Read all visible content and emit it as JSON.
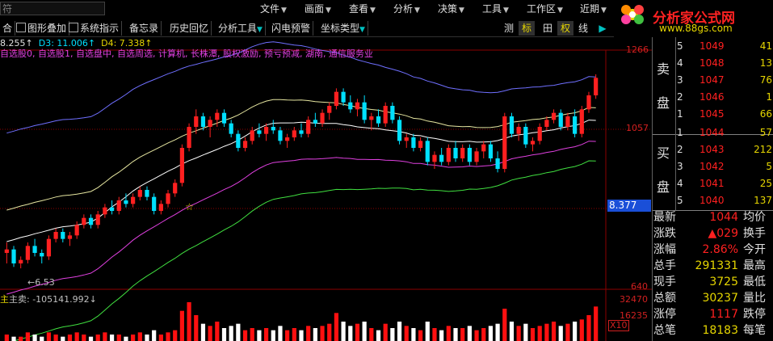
{
  "menubar": {
    "search_text": "符",
    "items": [
      "文件",
      "画面",
      "查看",
      "分析",
      "决策",
      "工具",
      "工作区",
      "近期"
    ]
  },
  "toolbar": {
    "items": [
      "合",
      "图形叠加",
      "系统指示",
      "备忘录",
      "历史回忆",
      "分析工具",
      "闪电预警",
      "坐标类型"
    ],
    "right_buttons": [
      "测",
      "标",
      "田",
      "权",
      "线"
    ]
  },
  "logo": {
    "title": "分析家公式网",
    "url": "www.88gs.com"
  },
  "indicator_line": {
    "d2": "8.255↑",
    "d3": "D3: 11.006↑",
    "d4": "D4: 7.338↑"
  },
  "stock_info": "自选股0, 自选股1, 自选盘中, 自选周选, 计算机, 长株潭, 股权激励, 预亏预减, 湖南, 通信服务业",
  "price_axis": {
    "top": "1266",
    "mid": "1057",
    "low": "640",
    "current": "8.377"
  },
  "volume_axis": {
    "top": "32470",
    "mid": "16235",
    "unit": "X10"
  },
  "annotations": {
    "low_mark": "←6.53"
  },
  "volume_label": "主卖: -105141.992↓",
  "colors": {
    "up": "#ff2020",
    "down": "#00e0ff",
    "accent": "#e6d600",
    "magenta": "#e040e0"
  },
  "chart_data": {
    "type": "candlestick",
    "price_axis_labels": [
      "1266",
      "1057",
      "640"
    ],
    "volume_axis_labels": [
      "32470",
      "16235"
    ],
    "candles": [
      [
        6.75,
        6.9,
        6.6,
        6.8
      ],
      [
        6.8,
        6.85,
        6.55,
        6.6
      ],
      [
        6.6,
        6.7,
        6.53,
        6.65
      ],
      [
        6.65,
        6.9,
        6.6,
        6.85
      ],
      [
        6.85,
        6.95,
        6.7,
        6.75
      ],
      [
        6.75,
        6.8,
        6.6,
        6.7
      ],
      [
        6.7,
        7.0,
        6.65,
        6.95
      ],
      [
        6.95,
        7.1,
        6.9,
        7.05
      ],
      [
        7.05,
        7.1,
        6.9,
        6.95
      ],
      [
        6.95,
        7.05,
        6.85,
        7.0
      ],
      [
        7.0,
        7.2,
        6.95,
        7.15
      ],
      [
        7.15,
        7.3,
        7.1,
        7.25
      ],
      [
        7.25,
        7.3,
        7.1,
        7.15
      ],
      [
        7.15,
        7.35,
        7.1,
        7.3
      ],
      [
        7.3,
        7.45,
        7.25,
        7.4
      ],
      [
        7.4,
        7.5,
        7.3,
        7.35
      ],
      [
        7.35,
        7.55,
        7.3,
        7.5
      ],
      [
        7.5,
        7.6,
        7.4,
        7.45
      ],
      [
        7.45,
        7.6,
        7.4,
        7.55
      ],
      [
        7.55,
        7.7,
        7.5,
        7.65
      ],
      [
        7.65,
        7.7,
        7.5,
        7.55
      ],
      [
        7.55,
        7.6,
        7.3,
        7.35
      ],
      [
        7.35,
        7.5,
        7.3,
        7.45
      ],
      [
        7.45,
        7.65,
        7.4,
        7.6
      ],
      [
        7.6,
        7.8,
        7.55,
        7.75
      ],
      [
        7.75,
        8.3,
        7.7,
        8.25
      ],
      [
        8.25,
        8.6,
        8.2,
        8.55
      ],
      [
        8.55,
        8.8,
        8.45,
        8.7
      ],
      [
        8.7,
        8.75,
        8.5,
        8.55
      ],
      [
        8.55,
        8.7,
        8.4,
        8.65
      ],
      [
        8.65,
        8.8,
        8.55,
        8.75
      ],
      [
        8.75,
        8.8,
        8.55,
        8.6
      ],
      [
        8.6,
        8.65,
        8.4,
        8.45
      ],
      [
        8.45,
        8.5,
        8.2,
        8.25
      ],
      [
        8.25,
        8.4,
        8.2,
        8.35
      ],
      [
        8.35,
        8.55,
        8.3,
        8.5
      ],
      [
        8.5,
        8.6,
        8.4,
        8.45
      ],
      [
        8.45,
        8.6,
        8.35,
        8.55
      ],
      [
        8.55,
        8.65,
        8.45,
        8.5
      ],
      [
        8.5,
        8.55,
        8.3,
        8.35
      ],
      [
        8.35,
        8.45,
        8.25,
        8.4
      ],
      [
        8.4,
        8.55,
        8.35,
        8.5
      ],
      [
        8.5,
        8.6,
        8.4,
        8.45
      ],
      [
        8.45,
        8.7,
        8.4,
        8.65
      ],
      [
        8.65,
        8.75,
        8.55,
        8.6
      ],
      [
        8.6,
        8.8,
        8.55,
        8.75
      ],
      [
        8.75,
        8.9,
        8.65,
        8.85
      ],
      [
        8.85,
        9.1,
        8.8,
        9.05
      ],
      [
        9.05,
        9.1,
        8.85,
        8.9
      ],
      [
        8.9,
        9.0,
        8.75,
        8.8
      ],
      [
        8.8,
        8.95,
        8.7,
        8.9
      ],
      [
        8.9,
        9.0,
        8.6,
        8.65
      ],
      [
        8.65,
        8.75,
        8.5,
        8.7
      ],
      [
        8.7,
        8.8,
        8.55,
        8.6
      ],
      [
        8.6,
        8.9,
        8.55,
        8.85
      ],
      [
        8.85,
        8.9,
        8.6,
        8.65
      ],
      [
        8.65,
        8.7,
        8.3,
        8.35
      ],
      [
        8.35,
        8.45,
        8.25,
        8.4
      ],
      [
        8.4,
        8.45,
        8.2,
        8.25
      ],
      [
        8.25,
        8.4,
        8.2,
        8.35
      ],
      [
        8.35,
        8.4,
        8.0,
        8.05
      ],
      [
        8.05,
        8.2,
        7.95,
        8.15
      ],
      [
        8.15,
        8.25,
        8.0,
        8.05
      ],
      [
        8.05,
        8.3,
        8.0,
        8.25
      ],
      [
        8.25,
        8.35,
        8.05,
        8.1
      ],
      [
        8.1,
        8.3,
        8.05,
        8.25
      ],
      [
        8.25,
        8.3,
        8.0,
        8.05
      ],
      [
        8.05,
        8.25,
        8.0,
        8.2
      ],
      [
        8.2,
        8.35,
        8.1,
        8.3
      ],
      [
        8.3,
        8.35,
        8.05,
        8.1
      ],
      [
        8.1,
        8.2,
        7.9,
        7.95
      ],
      [
        7.95,
        8.75,
        7.9,
        8.7
      ],
      [
        8.7,
        8.75,
        8.4,
        8.45
      ],
      [
        8.45,
        8.6,
        8.35,
        8.55
      ],
      [
        8.55,
        8.6,
        8.25,
        8.3
      ],
      [
        8.3,
        8.4,
        8.2,
        8.35
      ],
      [
        8.35,
        8.6,
        8.3,
        8.55
      ],
      [
        8.55,
        8.7,
        8.5,
        8.65
      ],
      [
        8.65,
        8.8,
        8.6,
        8.75
      ],
      [
        8.75,
        8.8,
        8.5,
        8.55
      ],
      [
        8.55,
        8.75,
        8.5,
        8.7
      ],
      [
        8.7,
        8.8,
        8.4,
        8.45
      ],
      [
        8.45,
        8.85,
        8.4,
        8.8
      ],
      [
        8.8,
        9.05,
        8.75,
        9.0
      ],
      [
        9.0,
        9.3,
        8.95,
        9.25
      ]
    ],
    "volumes": [
      3,
      2,
      2,
      4,
      3,
      2,
      4,
      3,
      2,
      3,
      4,
      3,
      2,
      3,
      4,
      3,
      3,
      2,
      3,
      4,
      3,
      5,
      3,
      4,
      5,
      14,
      18,
      12,
      8,
      7,
      9,
      6,
      7,
      8,
      5,
      6,
      5,
      6,
      5,
      7,
      5,
      6,
      5,
      7,
      6,
      7,
      8,
      13,
      9,
      7,
      8,
      9,
      6,
      5,
      8,
      6,
      9,
      7,
      6,
      5,
      9,
      6,
      5,
      7,
      6,
      6,
      7,
      5,
      6,
      7,
      8,
      15,
      9,
      7,
      8,
      6,
      7,
      8,
      9,
      7,
      8,
      9,
      10,
      12,
      16
    ],
    "bands": [
      "blue",
      "yellow",
      "white",
      "magenta",
      "green"
    ]
  },
  "order_book": {
    "sell_label": [
      "卖",
      "盘"
    ],
    "buy_label": [
      "买",
      "盘"
    ],
    "sell": [
      {
        "level": "5",
        "price": "1049",
        "vol": "41"
      },
      {
        "level": "4",
        "price": "1048",
        "vol": "13"
      },
      {
        "level": "3",
        "price": "1047",
        "vol": "76"
      },
      {
        "level": "2",
        "price": "1046",
        "vol": "1"
      },
      {
        "level": "1",
        "price": "1045",
        "vol": "66"
      }
    ],
    "buy": [
      {
        "level": "1",
        "price": "1044",
        "vol": "57"
      },
      {
        "level": "2",
        "price": "1043",
        "vol": "212"
      },
      {
        "level": "3",
        "price": "1042",
        "vol": "5"
      },
      {
        "level": "4",
        "price": "1041",
        "vol": "25"
      },
      {
        "level": "5",
        "price": "1040",
        "vol": "137"
      }
    ]
  },
  "stats": [
    {
      "k": "最新",
      "v": "1044",
      "k2": "均价",
      "color": "#ff2020"
    },
    {
      "k": "涨跌",
      "v": "▲029",
      "k2": "换手",
      "color": "#ff2020"
    },
    {
      "k": "涨幅",
      "v": "2.86%",
      "k2": "今开",
      "color": "#ff2020"
    },
    {
      "k": "总手",
      "v": "291331",
      "k2": "最高",
      "color": "#e6d600"
    },
    {
      "k": "现手",
      "v": "3725",
      "k2": "最低",
      "color": "#e6d600"
    },
    {
      "k": "总额",
      "v": "30237",
      "k2": "量比",
      "color": "#e6d600"
    },
    {
      "k": "涨停",
      "v": "1117",
      "k2": "跌停",
      "color": "#ff2020"
    },
    {
      "k": "总笔",
      "v": "18183",
      "k2": "每笔",
      "color": "#e6d600"
    }
  ]
}
